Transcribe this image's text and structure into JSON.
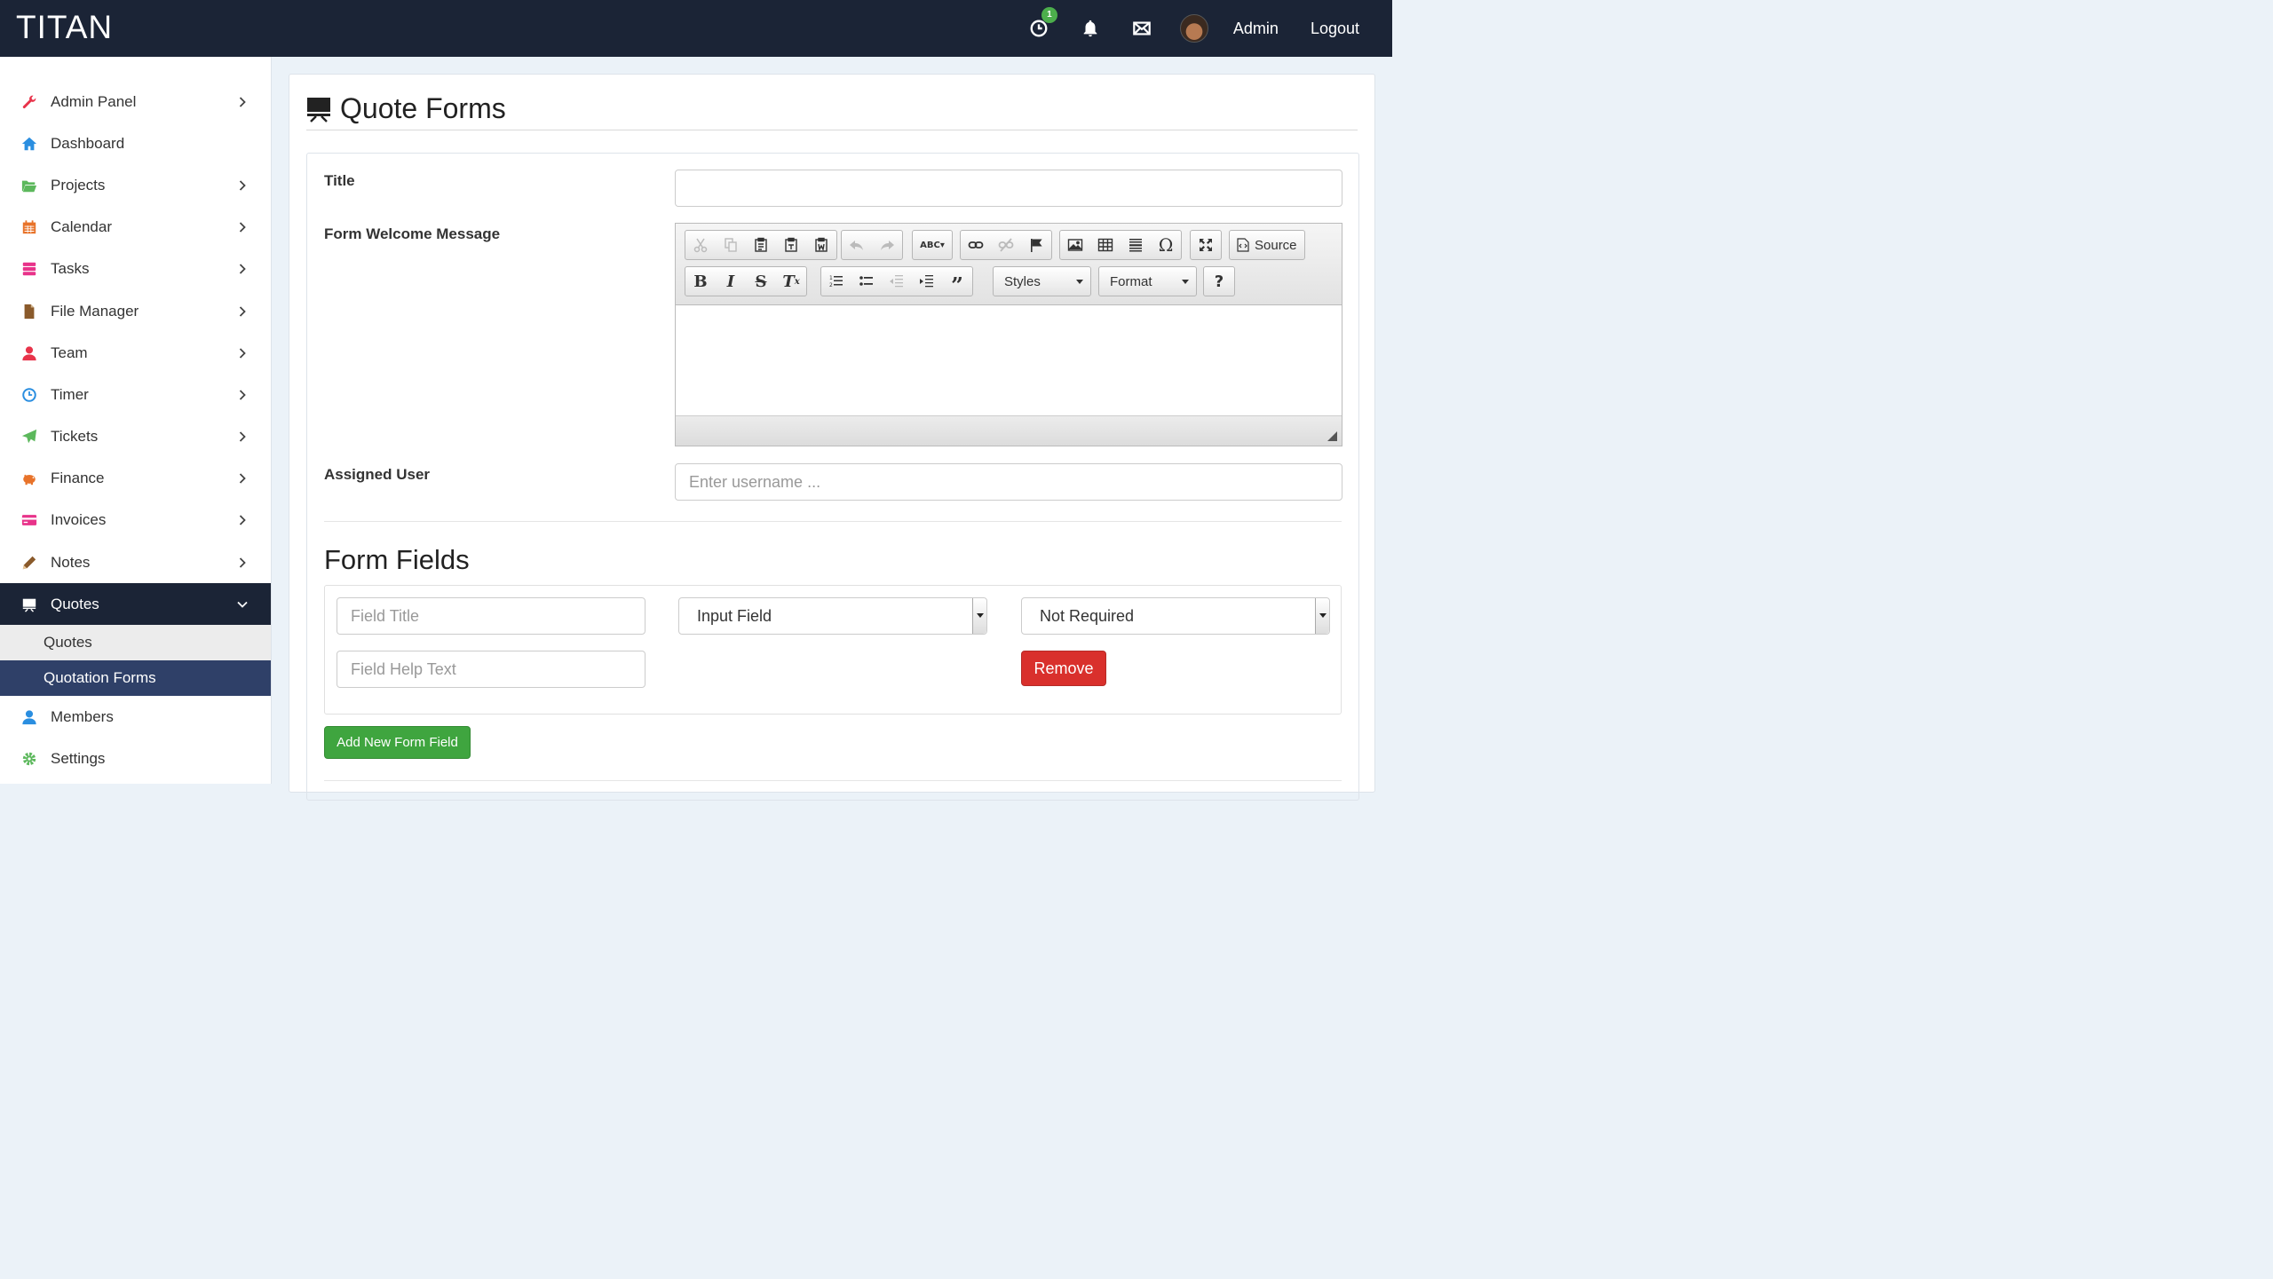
{
  "app": {
    "brand": "TITAN"
  },
  "topbar": {
    "timer_badge": "1",
    "user_name": "Admin",
    "logout_label": "Logout"
  },
  "sidebar": {
    "items": [
      {
        "label": "Admin Panel",
        "icon": "wrench-icon",
        "color": "#e8334a",
        "has_children": true
      },
      {
        "label": "Dashboard",
        "icon": "home-icon",
        "color": "#2a8ee0",
        "has_children": false
      },
      {
        "label": "Projects",
        "icon": "folder-open-icon",
        "color": "#5cb85c",
        "has_children": true
      },
      {
        "label": "Calendar",
        "icon": "calendar-icon",
        "color": "#e8732a",
        "has_children": true
      },
      {
        "label": "Tasks",
        "icon": "tasks-icon",
        "color": "#e8338a",
        "has_children": true
      },
      {
        "label": "File Manager",
        "icon": "file-icon",
        "color": "#8a5a2b",
        "has_children": true
      },
      {
        "label": "Team",
        "icon": "user-icon",
        "color": "#e8334a",
        "has_children": true
      },
      {
        "label": "Timer",
        "icon": "clock-icon",
        "color": "#2a8ee0",
        "has_children": true
      },
      {
        "label": "Tickets",
        "icon": "send-icon",
        "color": "#5cb85c",
        "has_children": true
      },
      {
        "label": "Finance",
        "icon": "piggy-bank-icon",
        "color": "#e8732a",
        "has_children": true
      },
      {
        "label": "Invoices",
        "icon": "credit-card-icon",
        "color": "#e8338a",
        "has_children": true
      },
      {
        "label": "Notes",
        "icon": "pencil-icon",
        "color": "#8a5a2b",
        "has_children": true
      }
    ],
    "quotes": {
      "label": "Quotes",
      "icon": "blackboard-icon",
      "children": [
        {
          "label": "Quotes"
        },
        {
          "label": "Quotation Forms"
        }
      ]
    },
    "after": [
      {
        "label": "Members",
        "icon": "user-icon",
        "color": "#2a8ee0"
      },
      {
        "label": "Settings",
        "icon": "gear-icon",
        "color": "#5cb85c"
      }
    ]
  },
  "page": {
    "title": "Quote Forms",
    "title_icon": "blackboard-icon"
  },
  "form": {
    "title_label": "Title",
    "title_value": "",
    "welcome_label": "Form Welcome Message",
    "editor": {
      "source_label": "Source",
      "styles_label": "Styles",
      "format_label": "Format",
      "help_label": "?"
    },
    "assigned_label": "Assigned User",
    "assigned_placeholder": "Enter username ..."
  },
  "form_fields": {
    "heading": "Form Fields",
    "field_title_placeholder": "Field Title",
    "field_help_placeholder": "Field Help Text",
    "field_type_selected": "Input Field",
    "required_selected": "Not Required",
    "remove_label": "Remove",
    "add_label": "Add New Form Field"
  }
}
